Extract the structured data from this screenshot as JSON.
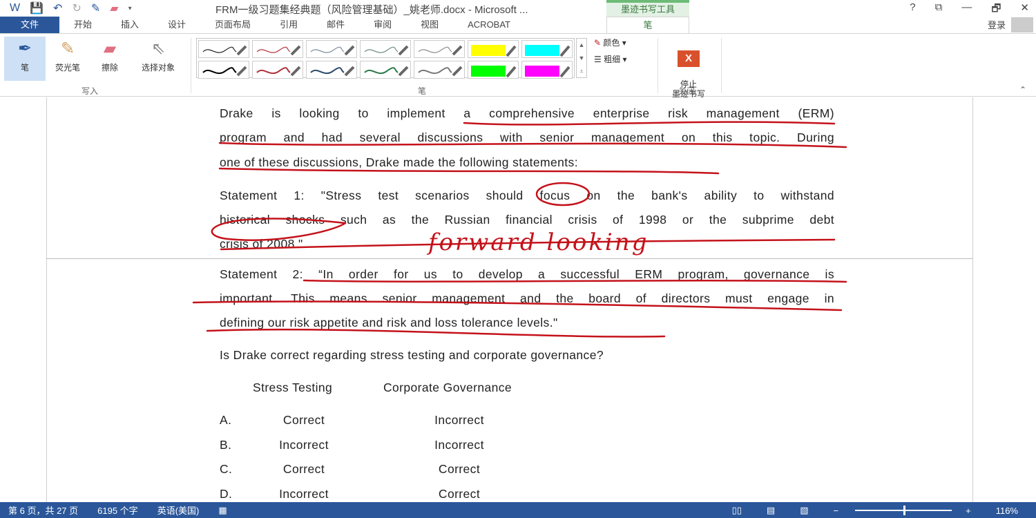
{
  "titlebar": {
    "title": "FRM一级习题集经典题（风险管理基础）_姚老师.docx - Microsoft ...",
    "context_tab": "墨迹书写工具",
    "help": "?",
    "restore": "⧉",
    "minimize": "—",
    "maximize": "🗗",
    "close": "✕"
  },
  "tabs": [
    "文件",
    "开始",
    "插入",
    "设计",
    "页面布局",
    "引用",
    "邮件",
    "审阅",
    "视图",
    "ACROBAT"
  ],
  "active_tab": "笔",
  "login": "登录",
  "ribbon": {
    "pen": "笔",
    "highlighter": "荧光笔",
    "eraser": "擦除",
    "select": "选择对象",
    "group_write": "写入",
    "group_pen": "笔",
    "color": "颜色",
    "thickness": "粗细",
    "stop": "停止\n墨迹书写",
    "group_close": "关闭"
  },
  "pens": [
    "#222222",
    "#b0303a",
    "#7a8a9a",
    "#6a8a7a",
    "#8a8a8a",
    "#ffff00",
    "#00ffff",
    "#000000",
    "#b0303a",
    "#2a4a6a",
    "#2a7a4a",
    "#777777",
    "#00ff00",
    "#ff00ff"
  ],
  "document": {
    "p1": [
      "Drake is looking to implement a comprehensive enterprise risk management (ERM)",
      "program and had several discussions with senior management on this topic. During",
      "one of these discussions, Drake made the following statements:"
    ],
    "p2": [
      "Statement 1: \"Stress test scenarios should focus on the bank's ability to withstand",
      "historical shocks such as the Russian financial crisis of 1998 or the subprime debt",
      "crisis of 2008.\""
    ],
    "handwriting": "forward  looking",
    "p3": [
      "Statement 2: “In order for us to develop a successful ERM program, governance is",
      "important. This means senior management and the board of directors must engage in",
      "defining our risk appetite and risk and loss tolerance levels.\""
    ],
    "question": "Is Drake correct regarding stress testing and corporate governance?",
    "headers": [
      "Stress Testing",
      "Corporate Governance"
    ],
    "options": [
      {
        "letter": "A.",
        "st": "Correct",
        "cg": "Incorrect"
      },
      {
        "letter": "B.",
        "st": "Incorrect",
        "cg": "Incorrect"
      },
      {
        "letter": "C.",
        "st": "Correct",
        "cg": "Correct"
      },
      {
        "letter": "D.",
        "st": "Incorrect",
        "cg": "Correct"
      }
    ]
  },
  "status": {
    "page": "第 6 页，共 27 页",
    "words": "6195 个字",
    "lang": "英语(美国)",
    "zoom": "116%"
  },
  "colors": {
    "accent": "#2b579a",
    "ink": "#c4121a"
  }
}
